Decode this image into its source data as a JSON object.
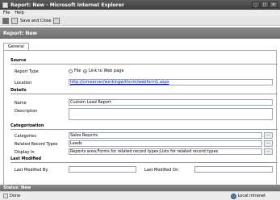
{
  "window": {
    "title": "Report: New - Microsoft Internet Explorer"
  },
  "menu": {
    "file": "File",
    "help": "Help"
  },
  "toolbar": {
    "save_close_label": "Save and Close"
  },
  "header": {
    "title": "Report: New"
  },
  "tabs": {
    "general": "General"
  },
  "source": {
    "section_title": "Source",
    "report_type_label": "Report Type",
    "option_file": "File",
    "option_link": "Link to Web page",
    "selected": "Link to Web page",
    "location_label": "Location",
    "location_value": "http://crmserver/workingwithcrm/webform1.aspx"
  },
  "details": {
    "section_title": "Details",
    "name_label": "Name",
    "name_value": "Custom Lead Report",
    "description_label": "Description",
    "description_value": ""
  },
  "categorization": {
    "section_title": "Categorization",
    "categories_label": "Categories",
    "categories_value": "Sales Reports",
    "related_label": "Related Record Types",
    "related_value": "Leads",
    "display_label": "Display In",
    "display_value": "Reports area;Forms for related record types;Lists for related record types",
    "lookup_glyph": "..."
  },
  "last_modified": {
    "section_title": "Last Modified",
    "by_label": "Last Modified By",
    "on_label": "Last Modified On"
  },
  "status": {
    "strip_text": "Status: New",
    "done": "Done",
    "zone": "Local intranet"
  },
  "icons": {
    "save": "save-icon",
    "save_close": "save-close-icon",
    "extra": "print-icon"
  },
  "colors": {
    "titlebar": "#3e3e3e",
    "header": "#6e6e6e",
    "link": "#00109c"
  }
}
